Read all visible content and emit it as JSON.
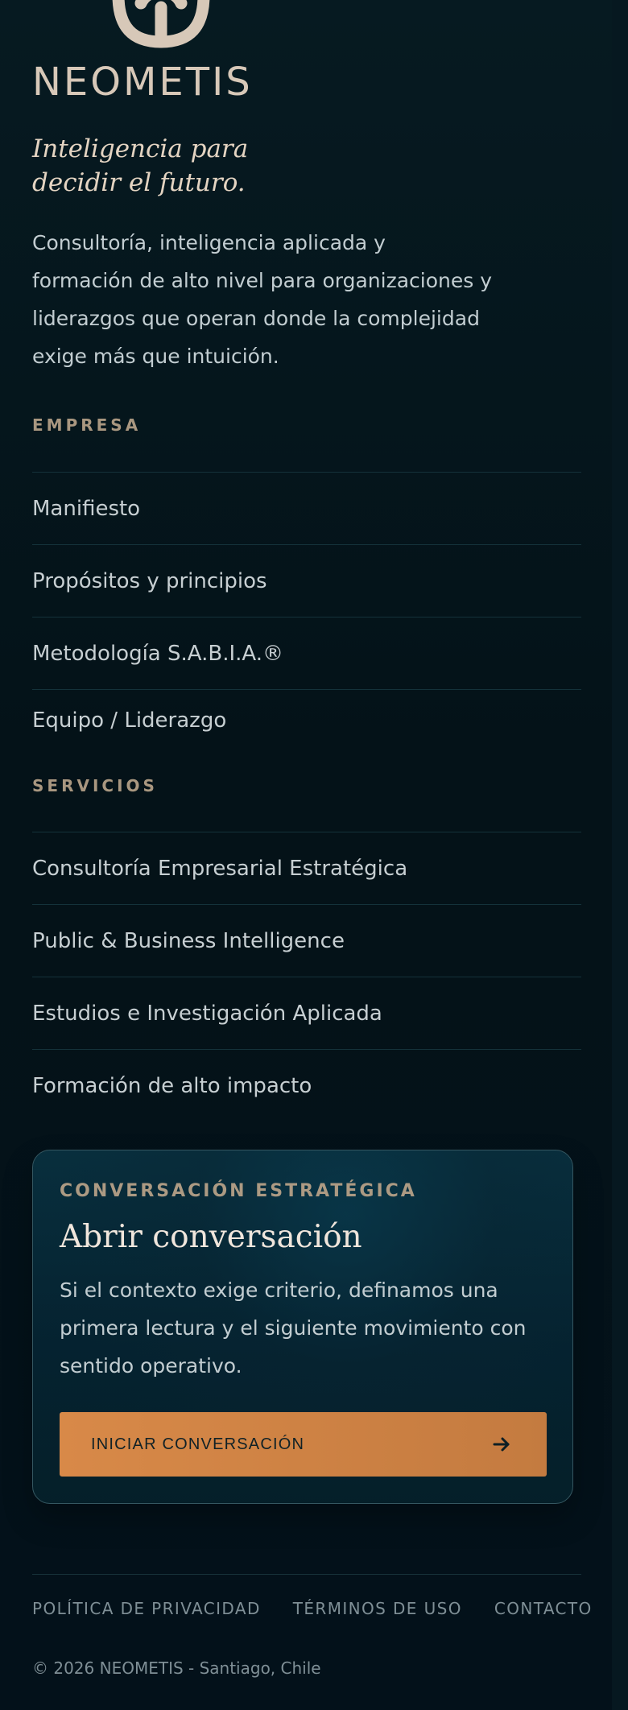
{
  "brand": {
    "logo_icon": "neometis-mark-icon",
    "wordmark": "NEOMETIS",
    "tagline_line1": "Inteligencia para",
    "tagline_line2": "decidir el futuro.",
    "intro_line1": "Consultoría, inteligencia aplicada y",
    "intro_line2": "formación de alto nivel para organizaciones y",
    "intro_line3": "liderazgos que operan donde la complejidad",
    "intro_line4": "exige más que intuición."
  },
  "company": {
    "title": "EMPRESA",
    "items": [
      {
        "label": "Manifiesto"
      },
      {
        "label": "Propósitos y principios"
      },
      {
        "label": "Metodología S.A.B.I.A.®"
      },
      {
        "label": "Equipo / Liderazgo"
      }
    ]
  },
  "services": {
    "title": "SERVICIOS",
    "items": [
      {
        "label": "Consultoría Empresarial Estratégica"
      },
      {
        "label": "Public & Business Intelligence"
      },
      {
        "label": "Estudios e Investigación Aplicada"
      },
      {
        "label": "Formación de alto impacto"
      }
    ]
  },
  "cta": {
    "kicker": "CONVERSACIÓN ESTRATÉGICA",
    "title": "Abrir conversación",
    "text_line1": "Si el contexto exige criterio, definamos una",
    "text_line2": "primera lectura y el siguiente movimiento con",
    "text_line3": "sentido operativo.",
    "button_label": "INICIAR CONVERSACIÓN",
    "button_icon": "arrow-right-icon"
  },
  "footer": {
    "links": [
      {
        "label": "POLÍTICA DE PRIVACIDAD"
      },
      {
        "label": "TÉRMINOS DE USO"
      },
      {
        "label": "CONTACTO"
      }
    ],
    "copyright": "© 2026 NEOMETIS - Santiago, Chile"
  },
  "colors": {
    "background": "#05161d",
    "accent": "#d88948",
    "cream": "#d7c8b8",
    "muted": "#7f8f96"
  }
}
